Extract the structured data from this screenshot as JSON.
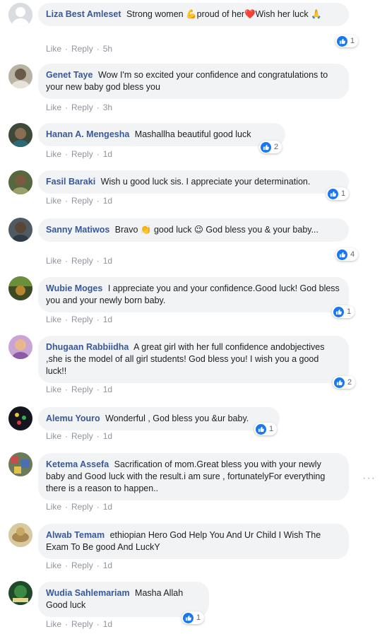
{
  "comments": [
    {
      "name": "Liza Best Amleset",
      "text": "Strong women 💪proud of her❤️Wish her luck 🙏",
      "time": "5h",
      "likes": "1"
    },
    {
      "name": "Genet Taye",
      "text": "Wow I'm so excited your confidence and congratulations to your new baby god bless you",
      "time": "3h",
      "likes": ""
    },
    {
      "name": "Hanan A. Mengesha",
      "text": "Mashallha beautiful good luck",
      "time": "1d",
      "likes": "2"
    },
    {
      "name": "Fasil Baraki",
      "text": "Wish u good luck sis. I appreciate your determination.",
      "time": "1d",
      "likes": "1"
    },
    {
      "name": "Sanny Matiwos",
      "text": "Bravo 👏 good luck 😉 God bless you & your baby...",
      "time": "1d",
      "likes": "4"
    },
    {
      "name": "Wubie Moges",
      "text": "I appreciate you and your confidence.Good luck! God bless you and your newly born baby.",
      "time": "1d",
      "likes": "1"
    },
    {
      "name": "Dhugaan Rabbiidha",
      "text": "A great girl with her full confidence andobjectives ,she is the model of all girl students! God bless you! I wish you a good luck!!",
      "time": "1d",
      "likes": "2"
    },
    {
      "name": "Alemu Youro",
      "text": "Wonderful , God bless you &ur baby.",
      "time": "1d",
      "likes": "1"
    },
    {
      "name": "Ketema Assefa",
      "text": "Sacrification of mom.Great bless you with your newly baby and Good luck with the result.i am sure , fortunatelyFor everything there is a reason to happen..",
      "time": "1d",
      "likes": ""
    },
    {
      "name": "Alwab Temam",
      "text": "ethiopian Hero God Help You And Ur Child I Wish The Exam To Be good And LuckY",
      "time": "1d",
      "likes": ""
    },
    {
      "name": "Wudia Sahlemariam",
      "text": "Masha Allah Good luck",
      "time": "1d",
      "likes": "1"
    }
  ],
  "labels": {
    "like": "Like",
    "reply": "Reply",
    "separator": "·",
    "more": "···"
  },
  "colors": {
    "name": "#385898",
    "bubble": "#f2f3f5",
    "like_blue": "#1877f2",
    "meta": "#90949c"
  }
}
